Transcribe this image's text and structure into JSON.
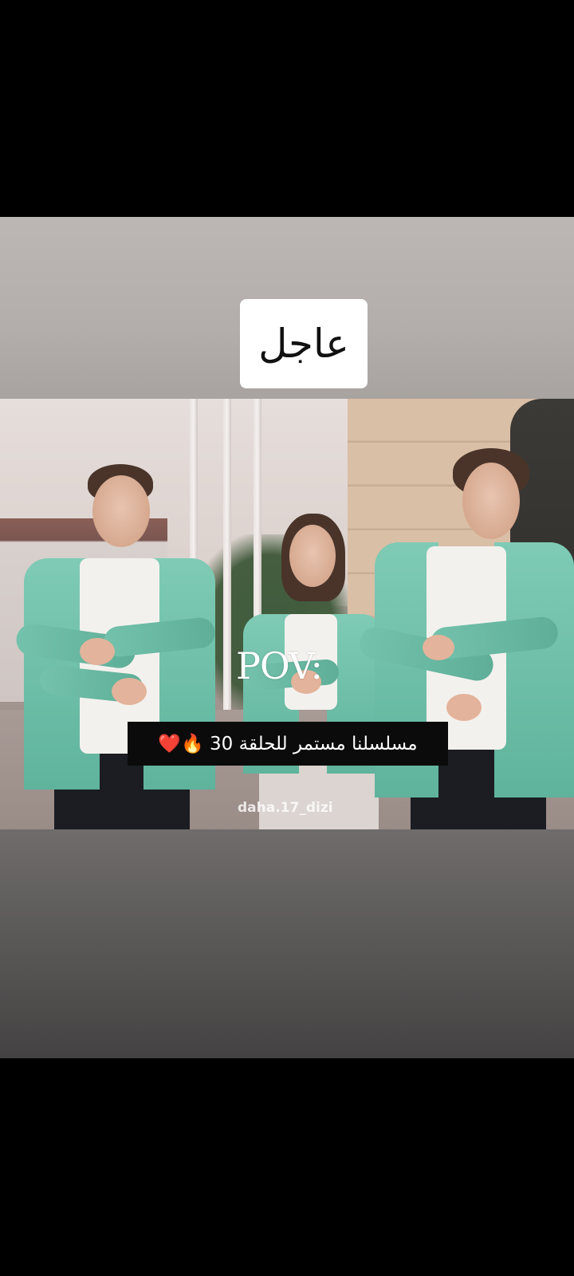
{
  "story": {
    "badge_text": "عاجل",
    "pov_text": "POV:",
    "caption_text": "مسلسلنا مستمر  للحلقة 30 🔥❤️",
    "watermark": "daha.17_dizi"
  },
  "colors": {
    "background": "#000000",
    "jacket": "#6fbfa7",
    "caption_bg": "#0b0b0b",
    "badge_bg": "#ffffff"
  }
}
